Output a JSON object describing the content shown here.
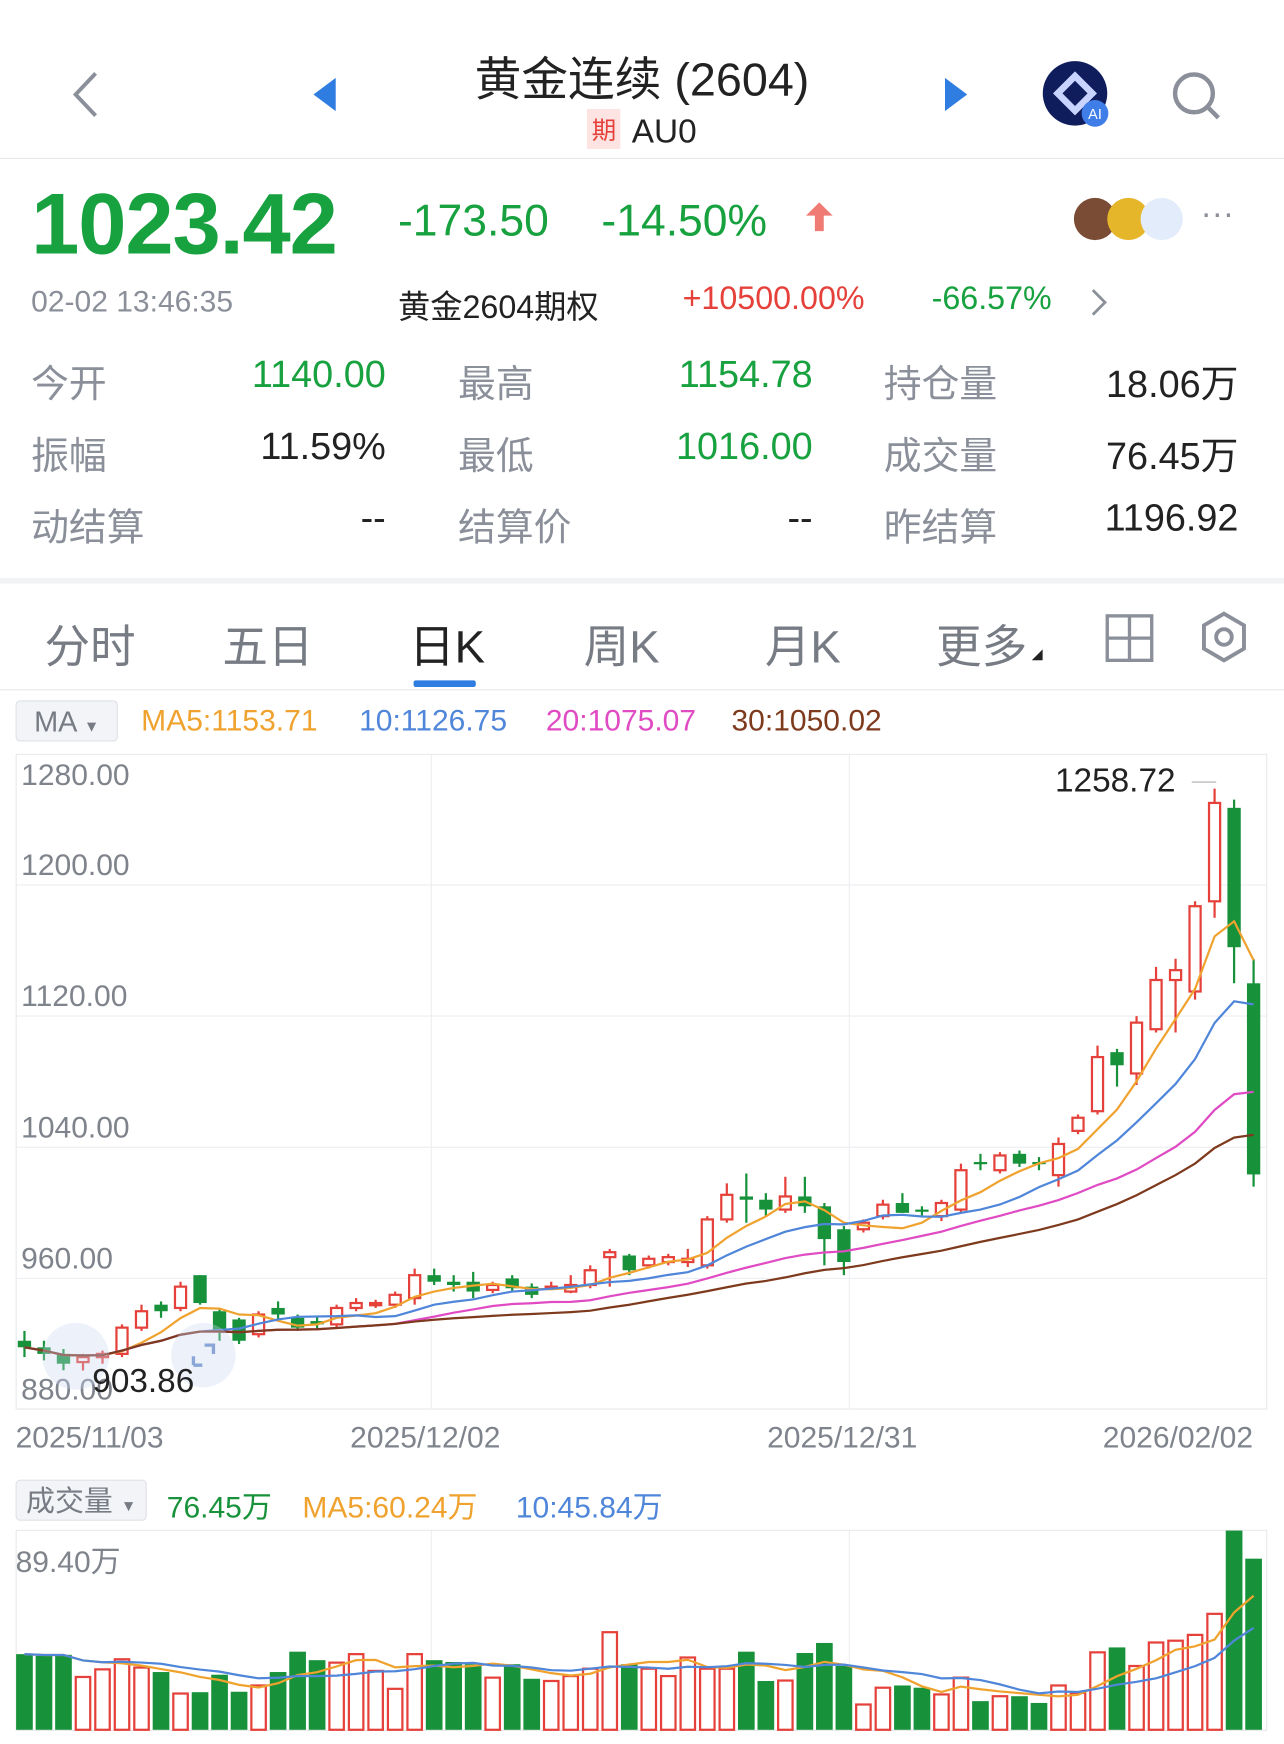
{
  "header": {
    "title": "黄金连续 (2604)",
    "badge": "期",
    "code": "AU0"
  },
  "quote": {
    "price": "1023.42",
    "change": "-173.50",
    "change_pct": "-14.50%",
    "timestamp": "02-02 13:46:35",
    "option_name": "黄金2604期权",
    "option_pct1": "+10500.00%",
    "option_pct2": "-66.57%"
  },
  "stats": [
    {
      "label": "今开",
      "value": "1140.00",
      "color": "green"
    },
    {
      "label": "最高",
      "value": "1154.78",
      "color": "green"
    },
    {
      "label": "持仓量",
      "value": "18.06万",
      "color": "dark"
    },
    {
      "label": "振幅",
      "value": "11.59%",
      "color": "dark"
    },
    {
      "label": "最低",
      "value": "1016.00",
      "color": "green"
    },
    {
      "label": "成交量",
      "value": "76.45万",
      "color": "dark"
    },
    {
      "label": "动结算",
      "value": "--",
      "color": "dark"
    },
    {
      "label": "结算价",
      "value": "--",
      "color": "dark"
    },
    {
      "label": "昨结算",
      "value": "1196.92",
      "color": "dark"
    }
  ],
  "tabs": [
    {
      "label": "分时"
    },
    {
      "label": "五日"
    },
    {
      "label": "日K",
      "active": true
    },
    {
      "label": "周K"
    },
    {
      "label": "月K"
    },
    {
      "label": "更多"
    }
  ],
  "ma_legend": {
    "selector": "MA",
    "ma5": "MA5:1153.71",
    "ma10": "10:1126.75",
    "ma20": "20:1075.07",
    "ma30": "30:1050.02"
  },
  "vol_legend": {
    "selector": "成交量",
    "vol": "76.45万",
    "ma5": "MA5:60.24万",
    "ma10": "10:45.84万"
  },
  "colors": {
    "up": "#e5413a",
    "down": "#17923a",
    "ma5": "#f0a22e",
    "ma10": "#4f86d9",
    "ma20": "#e04bc4",
    "ma30": "#7e3a1d",
    "accent": "#2f7de1"
  },
  "chart_data": {
    "type": "candlestick",
    "ylim": [
      880,
      1280
    ],
    "y_ticks": [
      "1280.00",
      "1200.00",
      "1120.00",
      "1040.00",
      "960.00",
      "880.00"
    ],
    "x_ticks": [
      "2025/11/03",
      "2025/12/02",
      "2025/12/31",
      "2026/02/02"
    ],
    "x_tick_index": [
      0,
      21,
      42,
      63
    ],
    "high_label": "1258.72",
    "low_label": "903.86",
    "ohlc": [
      [
        922,
        928,
        912,
        918
      ],
      [
        918,
        922,
        910,
        914
      ],
      [
        914,
        917,
        904,
        908
      ],
      [
        909,
        914,
        903.86,
        912
      ],
      [
        912,
        916,
        908,
        914
      ],
      [
        914,
        932,
        912,
        930
      ],
      [
        930,
        944,
        928,
        940
      ],
      [
        944,
        946,
        936,
        940
      ],
      [
        942,
        958,
        940,
        955
      ],
      [
        962,
        962,
        944,
        945
      ],
      [
        940,
        941,
        922,
        928
      ],
      [
        935,
        936,
        920,
        922
      ],
      [
        926,
        940,
        924,
        938
      ],
      [
        942,
        946,
        934,
        938
      ],
      [
        936,
        938,
        928,
        930
      ],
      [
        934,
        937,
        929,
        932
      ],
      [
        932,
        944,
        930,
        942
      ],
      [
        942,
        948,
        940,
        945
      ],
      [
        944,
        947,
        942,
        945
      ],
      [
        944,
        952,
        942,
        950
      ],
      [
        948,
        966,
        944,
        962
      ],
      [
        962,
        966,
        956,
        958
      ],
      [
        958,
        962,
        952,
        956
      ],
      [
        958,
        964,
        948,
        952
      ],
      [
        953,
        958,
        951,
        956
      ],
      [
        960,
        962,
        952,
        954
      ],
      [
        955,
        957,
        948,
        950
      ],
      [
        955,
        958,
        953,
        955
      ],
      [
        952,
        962,
        951,
        956
      ],
      [
        956,
        968,
        954,
        965
      ],
      [
        973,
        978,
        955,
        976
      ],
      [
        974,
        975,
        962,
        965
      ],
      [
        968,
        974,
        966,
        972
      ],
      [
        970,
        975,
        968,
        973
      ],
      [
        970,
        978,
        967,
        972
      ],
      [
        968,
        998,
        966,
        996
      ],
      [
        996,
        1018,
        994,
        1011
      ],
      [
        1010,
        1024,
        994,
        1008
      ],
      [
        1008,
        1012,
        998,
        1002
      ],
      [
        1002,
        1022,
        1000,
        1010
      ],
      [
        1010,
        1022,
        1000,
        1004
      ],
      [
        1004,
        1006,
        968,
        984
      ],
      [
        990,
        992,
        962,
        970
      ],
      [
        990,
        996,
        988,
        994
      ],
      [
        998,
        1008,
        996,
        1005
      ],
      [
        1006,
        1012,
        1000,
        1000
      ],
      [
        1002,
        1004,
        998,
        1001
      ],
      [
        998,
        1008,
        995,
        1006
      ],
      [
        1002,
        1030,
        1000,
        1026
      ],
      [
        1031,
        1036,
        1026,
        1030
      ],
      [
        1026,
        1037,
        1024,
        1035
      ],
      [
        1036,
        1038,
        1028,
        1030
      ],
      [
        1031,
        1034,
        1026,
        1030
      ],
      [
        1023,
        1046,
        1016,
        1042
      ],
      [
        1050,
        1060,
        1048,
        1058
      ],
      [
        1062,
        1102,
        1060,
        1095
      ],
      [
        1098,
        1100,
        1077,
        1090
      ],
      [
        1085,
        1120,
        1078,
        1116
      ],
      [
        1112,
        1150,
        1110,
        1142
      ],
      [
        1142,
        1155,
        1110,
        1148
      ],
      [
        1135,
        1190,
        1130,
        1187
      ],
      [
        1190,
        1258.72,
        1180,
        1250
      ],
      [
        1247,
        1252,
        1140,
        1162
      ],
      [
        1140,
        1154.78,
        1016,
        1023.42
      ]
    ],
    "volume_max_label": "89.40万",
    "volume_max": 89.4,
    "volume": [
      33.8,
      33,
      33.5,
      23.6,
      27,
      31.5,
      27.8,
      25.8,
      16.2,
      16.8,
      24.6,
      17,
      19.8,
      25.8,
      34.9,
      31.1,
      30,
      33.8,
      26.3,
      18.3,
      33.8,
      31.1,
      30.3,
      29.3,
      23.3,
      29.3,
      22.8,
      21.8,
      24,
      27.3,
      43.6,
      29.3,
      27.3,
      24,
      32.3,
      27.3,
      27.3,
      34.9,
      21.8,
      22,
      34.3,
      38.8,
      28.5,
      11.3,
      18.8,
      19.8,
      18.8,
      15.8,
      23.3,
      12.8,
      15,
      15,
      12,
      19.8,
      16.5,
      34.6,
      36.8,
      28.5,
      39,
      39.8,
      42.4,
      51.8,
      89,
      76.45
    ]
  }
}
